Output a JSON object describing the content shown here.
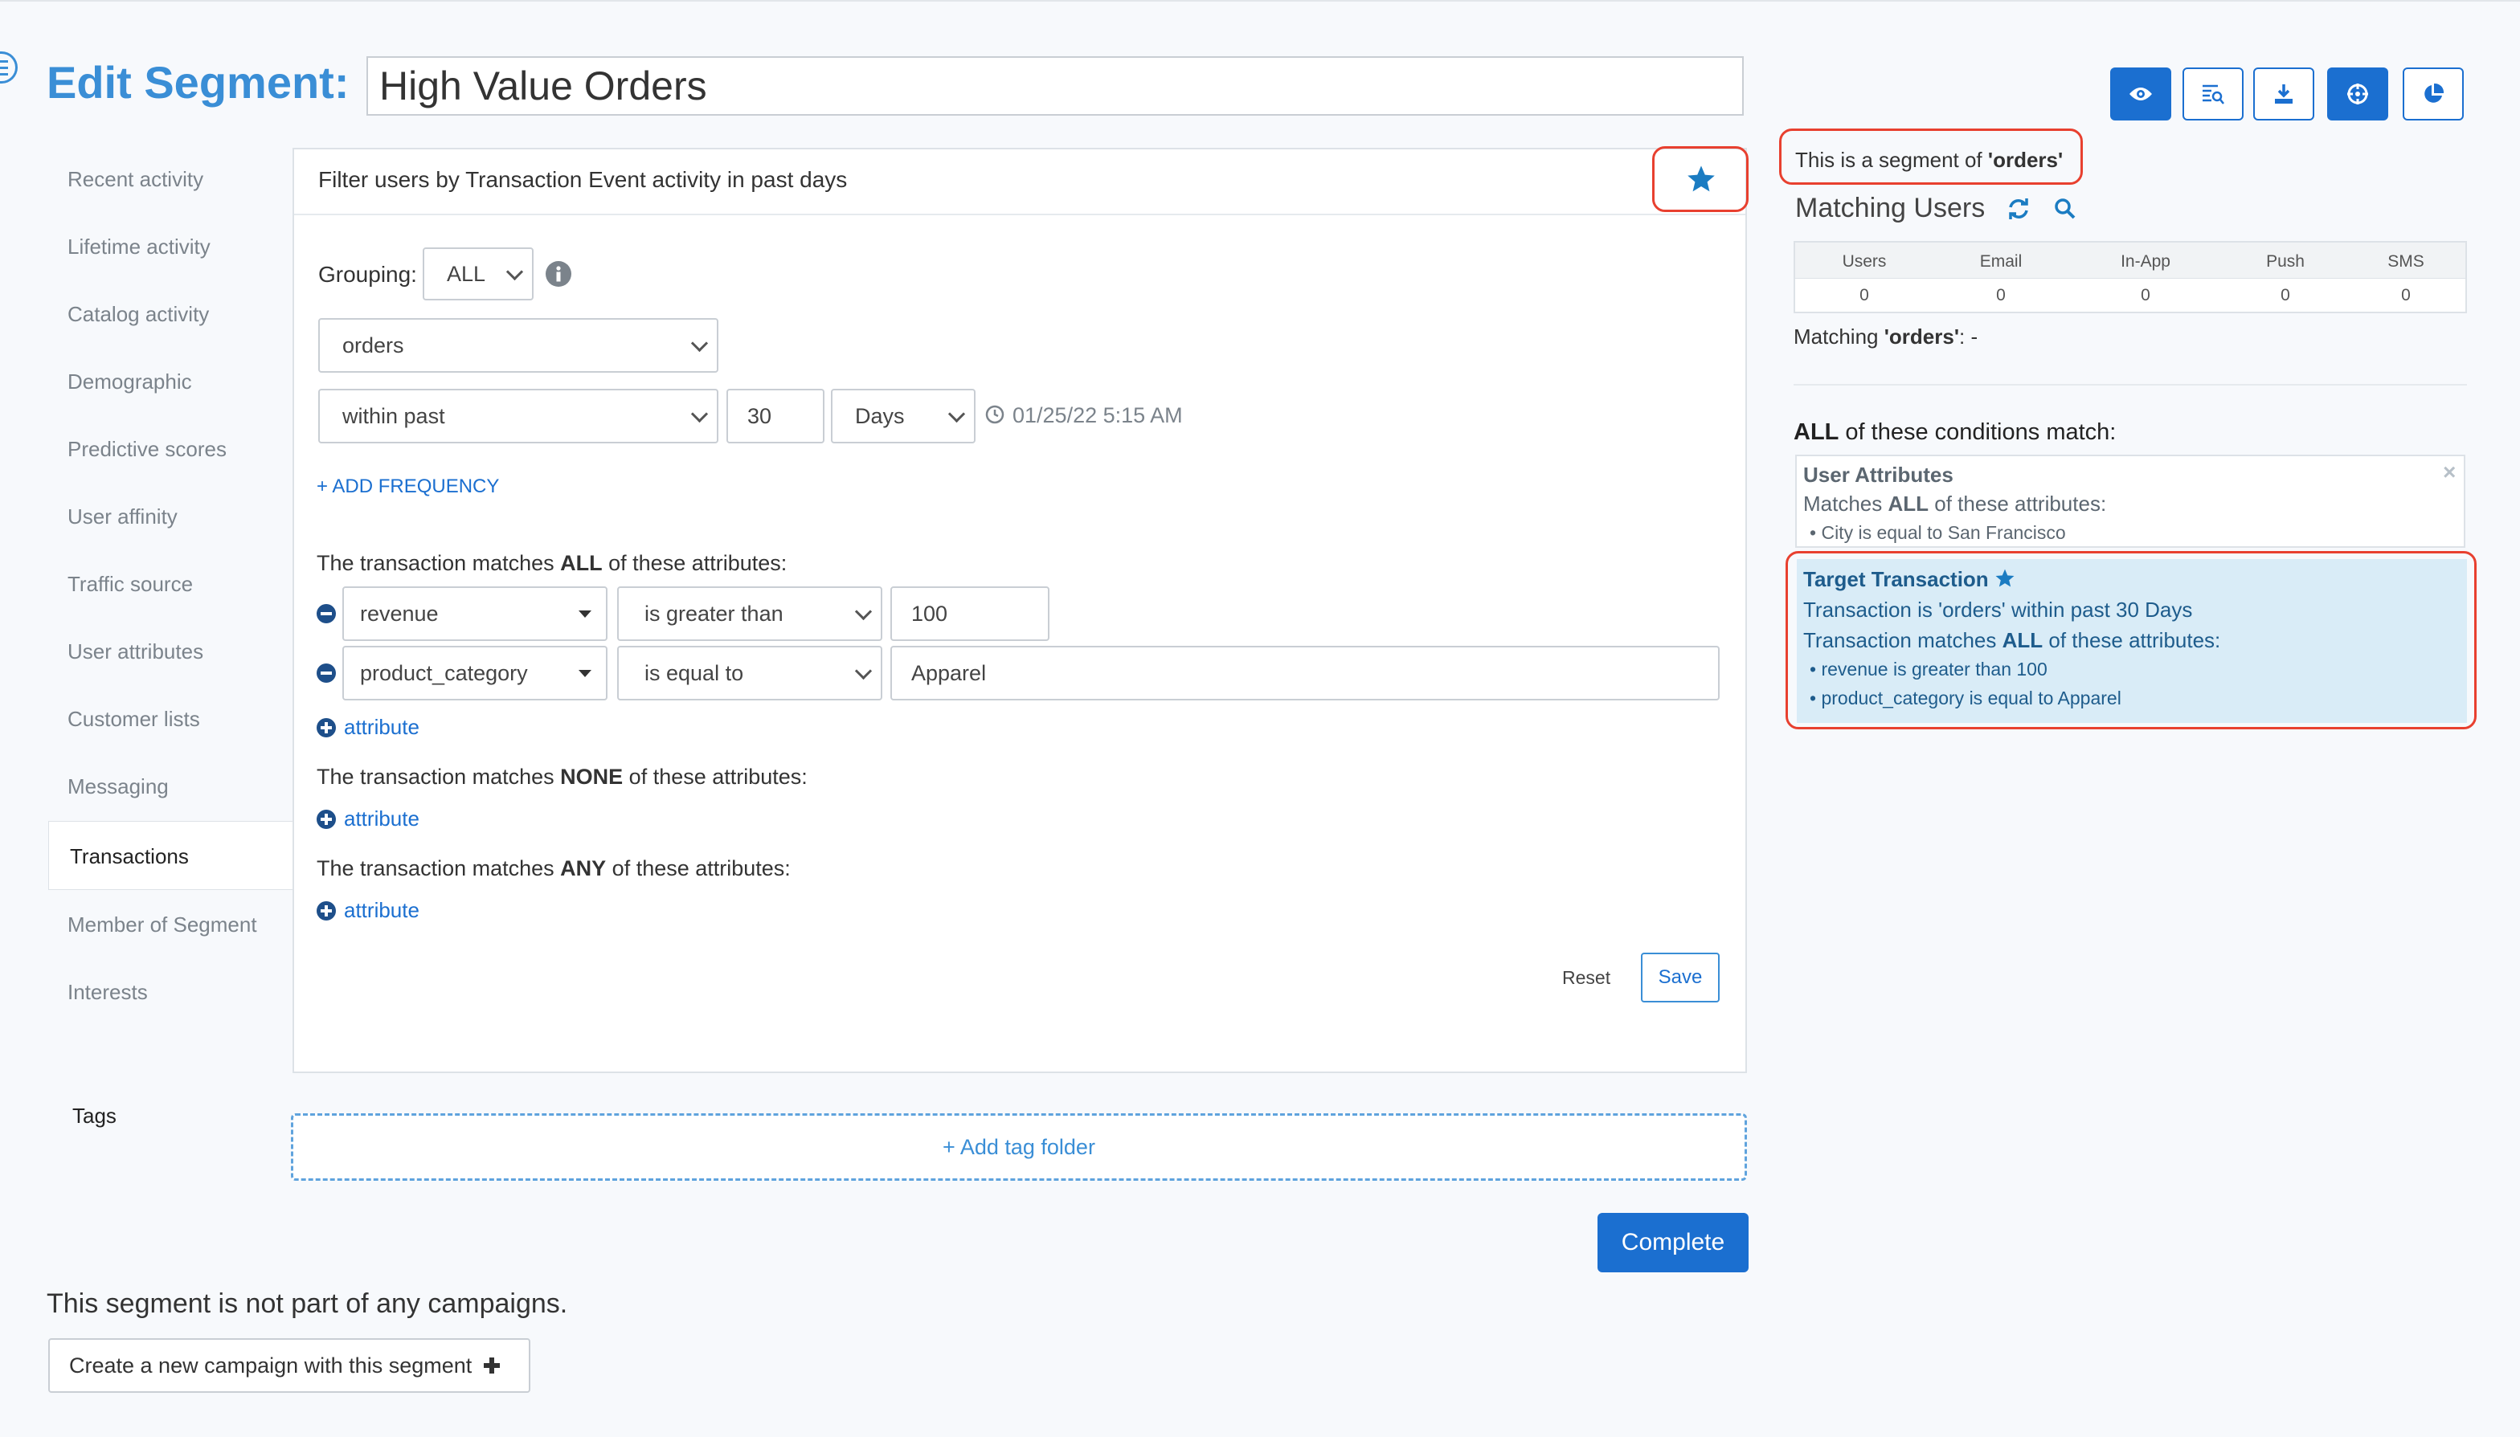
{
  "header": {
    "title": "Edit Segment:",
    "segment_name": "High Value Orders"
  },
  "toolbar": {
    "buttons": [
      {
        "name": "preview",
        "icon": "eye-icon"
      },
      {
        "name": "inspect",
        "icon": "search-list-icon"
      },
      {
        "name": "export",
        "icon": "download-icon"
      },
      {
        "name": "settings",
        "icon": "crosshair-icon"
      },
      {
        "name": "analytics",
        "icon": "pie-chart-icon"
      }
    ]
  },
  "sidebar": {
    "items": [
      {
        "label": "Recent activity"
      },
      {
        "label": "Lifetime activity"
      },
      {
        "label": "Catalog activity"
      },
      {
        "label": "Demographic"
      },
      {
        "label": "Predictive scores"
      },
      {
        "label": "User affinity"
      },
      {
        "label": "Traffic source"
      },
      {
        "label": "User attributes"
      },
      {
        "label": "Customer lists"
      },
      {
        "label": "Messaging"
      },
      {
        "label": "Transactions",
        "active": true
      },
      {
        "label": "Member of Segment"
      },
      {
        "label": "Interests"
      }
    ],
    "tags_label": "Tags"
  },
  "filter": {
    "header": "Filter users by Transaction Event activity in past days",
    "grouping_label": "Grouping:",
    "grouping_value": "ALL",
    "event_value": "orders",
    "time_mode": "within past",
    "time_amount": "30",
    "time_unit": "Days",
    "timestamp": "01/25/22 5:15 AM",
    "add_frequency": "+ ADD FREQUENCY",
    "all_section": {
      "prefix": "The transaction matches ",
      "keyword": "ALL",
      "suffix": " of these attributes:",
      "rows": [
        {
          "attribute": "revenue",
          "operator": "is greater than",
          "value": "100"
        },
        {
          "attribute": "product_category",
          "operator": "is equal to",
          "value": "Apparel"
        }
      ],
      "add_label": "attribute"
    },
    "none_section": {
      "prefix": "The transaction matches ",
      "keyword": "NONE",
      "suffix": " of these attributes:",
      "add_label": "attribute"
    },
    "any_section": {
      "prefix": "The transaction matches ",
      "keyword": "ANY",
      "suffix": " of these attributes:",
      "add_label": "attribute"
    },
    "reset_label": "Reset",
    "save_label": "Save"
  },
  "tags": {
    "add_folder": "+ Add tag folder"
  },
  "complete_label": "Complete",
  "campaigns": {
    "message": "This segment is not part of any campaigns.",
    "create_label": "Create a new campaign with this segment"
  },
  "right_panel": {
    "segment_of_prefix": "This is a segment of ",
    "segment_of_value": "'orders'",
    "matching_users_title": "Matching Users",
    "stats": {
      "columns": [
        "Users",
        "Email",
        "In-App",
        "Push",
        "SMS"
      ],
      "values": [
        "0",
        "0",
        "0",
        "0",
        "0"
      ]
    },
    "matching_prefix": "Matching ",
    "matching_key": "'orders'",
    "matching_suffix": ": -",
    "conditions_keyword": "ALL",
    "conditions_suffix": " of these conditions match:",
    "user_attributes": {
      "title": "User Attributes",
      "match_prefix": "Matches ",
      "match_keyword": "ALL",
      "match_suffix": " of these attributes:",
      "items": [
        "City is equal to San Francisco"
      ]
    },
    "target_transaction": {
      "title": "Target Transaction",
      "line1": "Transaction is 'orders' within past 30 Days",
      "match_prefix": "Transaction matches ",
      "match_keyword": "ALL",
      "match_suffix": " of these attributes:",
      "items": [
        "revenue is greater than 100",
        "product_category is equal to Apparel"
      ]
    }
  },
  "colors": {
    "accent": "#1b6fd0",
    "title_blue": "#3a8ed6",
    "callout_red": "#e8402f",
    "target_bg": "#d9ecf7"
  }
}
